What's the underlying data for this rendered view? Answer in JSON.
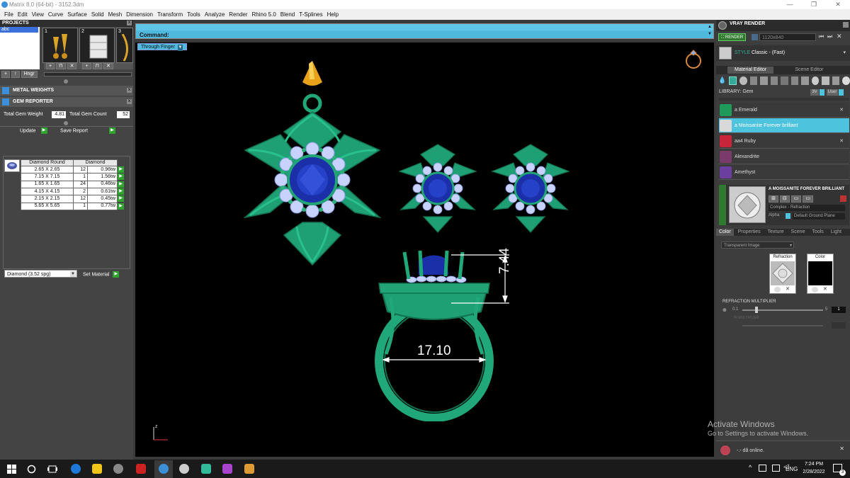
{
  "window": {
    "title": "Matrix 8.0 (64-bit) - 3152.3dm",
    "controls": [
      "—",
      "❐",
      "✕"
    ]
  },
  "menu": [
    "File",
    "Edit",
    "View",
    "Curve",
    "Surface",
    "Solid",
    "Mesh",
    "Dimension",
    "Transform",
    "Tools",
    "Analyze",
    "Render",
    "Rhino 5.0",
    "Blend",
    "T-Splines",
    "Help"
  ],
  "projects": {
    "header": "PROJECTS",
    "tree_item": "abc",
    "thumb_numbers": [
      "1",
      "2",
      "3"
    ],
    "buttons": [
      "+",
      "↑",
      "Hngr"
    ]
  },
  "metal_weights": {
    "header": "METAL WEIGHTS"
  },
  "gem_reporter": {
    "header": "GEM REPORTER",
    "total_gem_weight_label": "Total Gem Weight",
    "total_gem_weight": "4.81",
    "total_gem_count_label": "Total Gem Count",
    "total_gem_count": "52",
    "update_label": "Update",
    "save_report_label": "Save Report",
    "table_headers": [
      "Diamond Round",
      "Diamond"
    ],
    "rows": [
      {
        "size": "2.65 X 2.65",
        "count": "12",
        "weight": "0.96tw"
      },
      {
        "size": "7.15 X 7.15",
        "count": "1",
        "weight": "1.56tw"
      },
      {
        "size": "1.65 X 1.65",
        "count": "24",
        "weight": "0.46tw"
      },
      {
        "size": "4.15 X 4.15",
        "count": "2",
        "weight": "0.61tw"
      },
      {
        "size": "2.15 X 2.15",
        "count": "12",
        "weight": "0.45tw"
      },
      {
        "size": "5.65 X 5.65",
        "count": "1",
        "weight": "0.77tw"
      }
    ],
    "material_select": "Diamond      (3.52 spg)",
    "set_material_label": "Set Material"
  },
  "command": {
    "label": "Command:"
  },
  "viewport": {
    "view_label": "Through Finger",
    "dim_height": "7.44",
    "dim_width": "17.10",
    "axis_label": "z"
  },
  "vray": {
    "header": "VRAY RENDER",
    "render_label": "RENDER",
    "resolution": "1120x840",
    "style_label": "STYLE",
    "style_value": "Classic - (Fast)",
    "tabs": [
      "Material Editor",
      "Scene Editor"
    ],
    "library_label": "LIBRARY: Gem",
    "library_btn": "User",
    "library_items": [
      {
        "name": "a Emerald",
        "color": "#1f9a5a"
      },
      {
        "name": "a Moissanite Forever brilliant",
        "color": "#d9d9d9"
      },
      {
        "name": "aa4 Ruby",
        "color": "#c8253a"
      },
      {
        "name": "Alexandrite",
        "color": "#7a3a6a"
      },
      {
        "name": "Amethyst",
        "color": "#6b3fa0"
      }
    ],
    "material_name": "A MOISSANITE FOREVER BRILLIANT",
    "material_type": "Complex - Refraction",
    "alpha_label": "Alpha",
    "ground_plane": "Default Ground Plane",
    "sub_tabs": [
      "Color",
      "Properties",
      "Texture",
      "Scene",
      "Tools",
      "Light"
    ],
    "transparency_select": "Transparent Image",
    "refraction_label": "Refraction",
    "color_label": "Color",
    "refraction_multiplier_label": "REFRACTION MULTIPLIER",
    "slider_min": "0.1",
    "slider_max": "5",
    "slider_value": "1",
    "ir_multiplier_label": "IR MULTIPLIER",
    "accent": "#4ec3dd"
  },
  "watermark": {
    "line1": "Activate Windows",
    "line2": "Go to Settings to activate Windows."
  },
  "notification": {
    "text": "-.- dã online."
  },
  "taskbar": {
    "lang": "ENG",
    "time": "7:24 PM",
    "date": "2/28/2022",
    "notif_count": "3"
  }
}
